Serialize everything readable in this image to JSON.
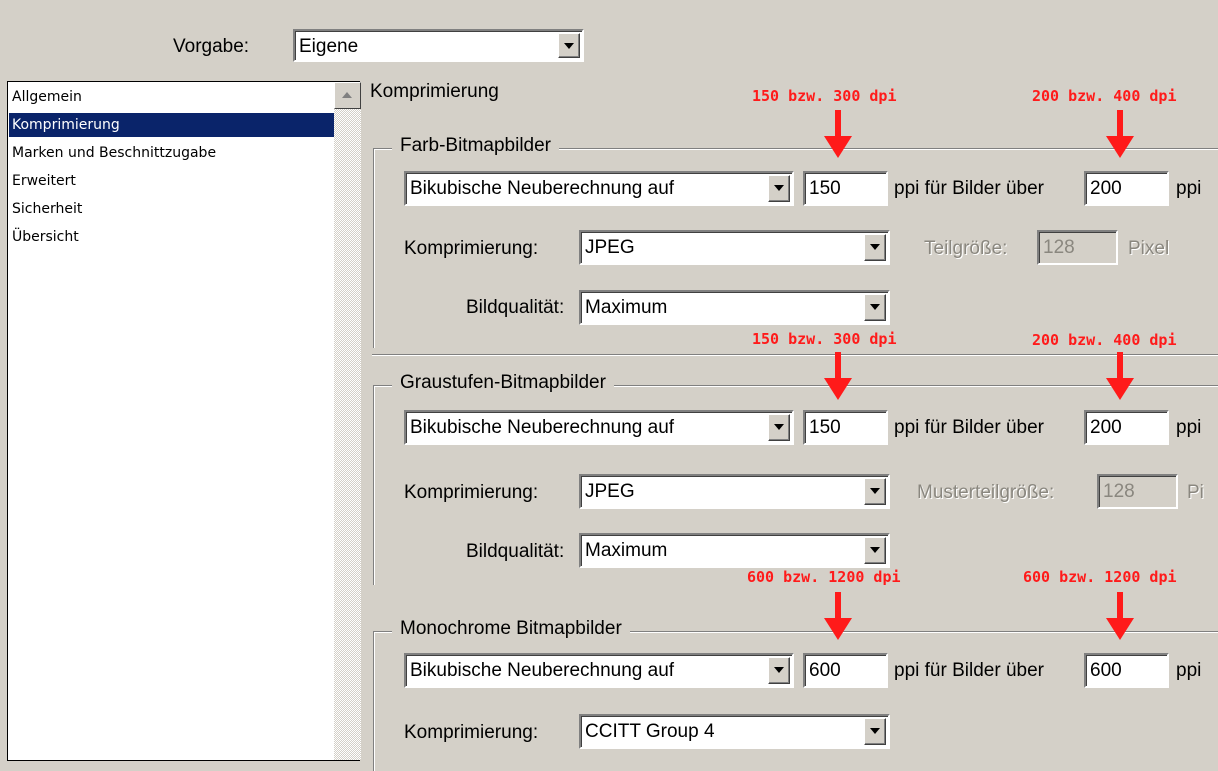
{
  "preset": {
    "label": "Vorgabe:",
    "value": "Eigene"
  },
  "sidebar": {
    "items": [
      {
        "label": "Allgemein"
      },
      {
        "label": "Komprimierung"
      },
      {
        "label": "Marken und Beschnittzugabe"
      },
      {
        "label": "Erweitert"
      },
      {
        "label": "Sicherheit"
      },
      {
        "label": "Übersicht"
      }
    ],
    "selected": "Komprimierung"
  },
  "section_title": "Komprimierung",
  "groups": {
    "color": {
      "title": "Farb-Bitmapbilder",
      "resample": "Bikubische Neuberechnung auf",
      "ppi_value": "150",
      "ppi_text": "ppi für Bilder über",
      "above_value": "200",
      "ppi_unit": "ppi",
      "compression_label": "Komprimierung:",
      "compression": "JPEG",
      "tile_label": "Teilgröße:",
      "tile_value": "128",
      "tile_unit": "Pixel",
      "quality_label": "Bildqualität:",
      "quality": "Maximum"
    },
    "gray": {
      "title": "Graustufen-Bitmapbilder",
      "resample": "Bikubische Neuberechnung auf",
      "ppi_value": "150",
      "ppi_text": "ppi für Bilder über",
      "above_value": "200",
      "ppi_unit": "ppi",
      "compression_label": "Komprimierung:",
      "compression": "JPEG",
      "tile_label": "Musterteilgröße:",
      "tile_value": "128",
      "tile_unit": "Pi",
      "quality_label": "Bildqualität:",
      "quality": "Maximum"
    },
    "mono": {
      "title": "Monochrome Bitmapbilder",
      "resample": "Bikubische Neuberechnung auf",
      "ppi_value": "600",
      "ppi_text": "ppi für Bilder über",
      "above_value": "600",
      "ppi_unit": "ppi",
      "compression_label": "Komprimierung:",
      "compression": "CCITT Group 4"
    }
  },
  "annotations": {
    "color_left": "150 bzw. 300 dpi",
    "color_right": "200 bzw. 400 dpi",
    "gray_left": "150 bzw. 300 dpi",
    "gray_right": "200 bzw. 400 dpi",
    "mono_left": "600 bzw. 1200 dpi",
    "mono_right": "600 bzw. 1200 dpi",
    "color": "#ff1a1a"
  }
}
